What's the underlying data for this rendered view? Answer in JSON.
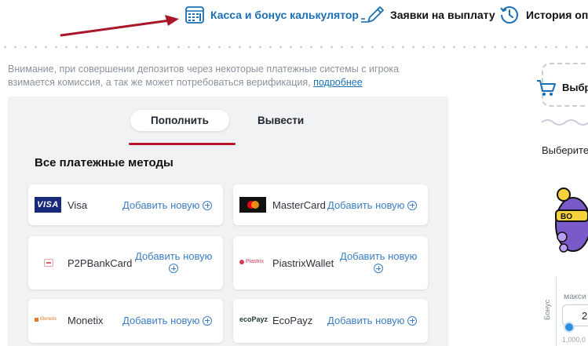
{
  "nav": {
    "cashier_label": "Касса и бонус калькулятор",
    "withdraw_label": "Заявки на выплату",
    "history_label": "История опе"
  },
  "notice": {
    "text": "Внимание, при совершении депозитов через некоторые платежные системы с игрока взимается комиссия, а так же может потребоваться верификация,",
    "link": "подробнее"
  },
  "tabs": {
    "deposit": "Пополнить",
    "withdraw": "Вывести"
  },
  "methods": {
    "title": "Все платежные методы",
    "add_label": "Добавить новую",
    "items": [
      {
        "name": "Visa",
        "logo_text": "VISA"
      },
      {
        "name": "MasterCard",
        "logo_text": ""
      },
      {
        "name": "P2PBankCard",
        "logo_text": ""
      },
      {
        "name": "PiastrixWallet",
        "logo_text": "Piastrix"
      },
      {
        "name": "Monetix",
        "logo_text": "Monetix"
      },
      {
        "name": "EcoPayz",
        "logo_text": "ecoPayz"
      }
    ]
  },
  "sidebar": {
    "choose_bonus_cut": "Выбра",
    "choose_cut": "Выберите",
    "max_cut": "макси",
    "input_value": "2",
    "bonus_vertical": "Бонус",
    "amount_cut": "1,000,0"
  },
  "colors": {
    "accent_blue": "#1a6fb4",
    "link_blue": "#3d7ec4",
    "underline_red": "#b3142b",
    "arrow_red": "#a8162a",
    "panel_bg": "#f1f2f4"
  }
}
